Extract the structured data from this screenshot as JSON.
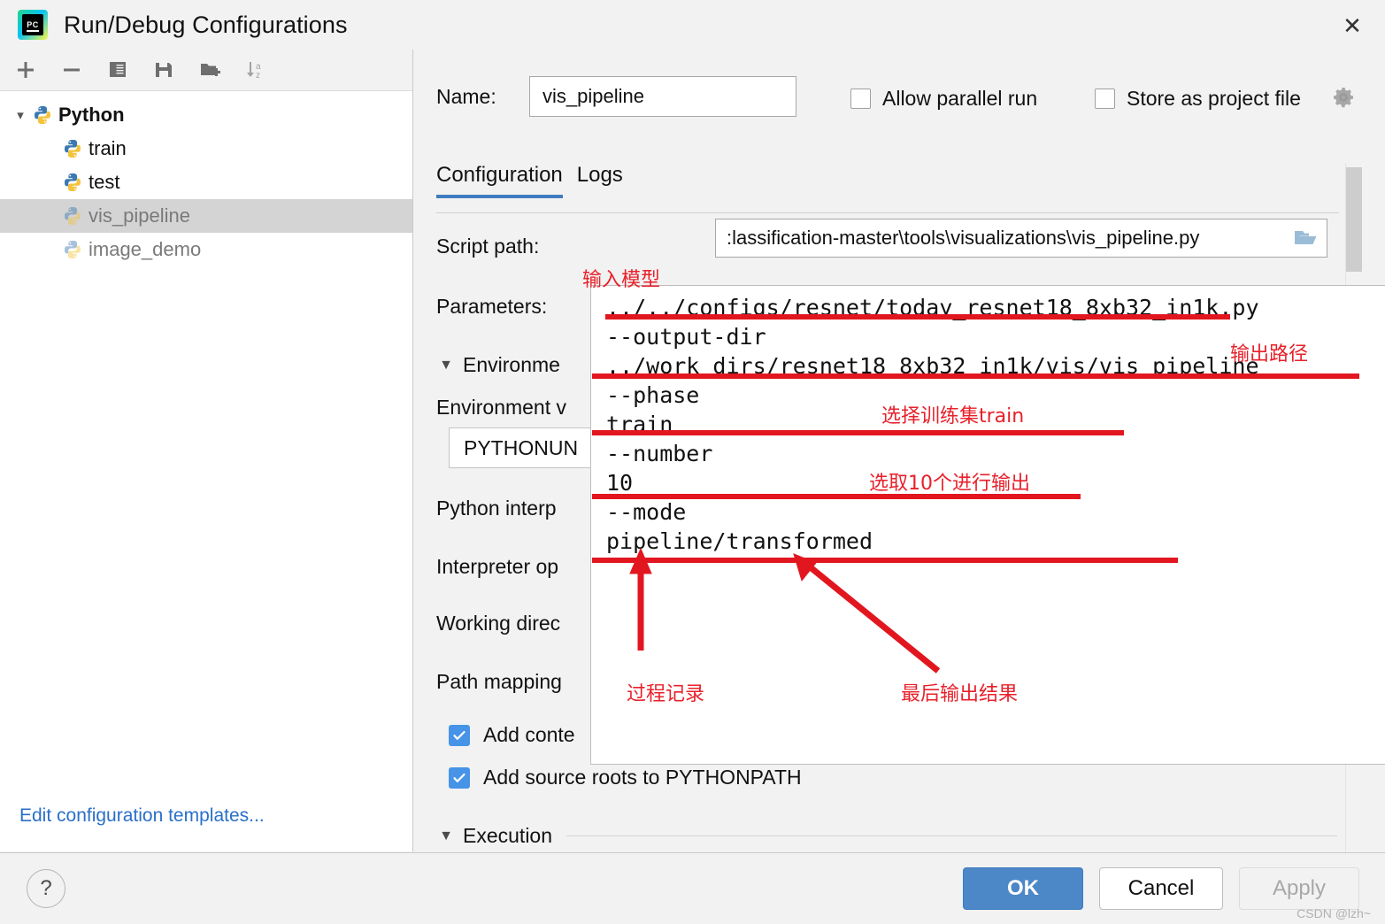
{
  "window": {
    "title": "Run/Debug Configurations",
    "logo_text": "PC",
    "close_icon": "close-icon"
  },
  "toolbar": {
    "items": [
      {
        "name": "add-configuration",
        "icon": "plus-icon"
      },
      {
        "name": "remove-configuration",
        "icon": "minus-icon"
      },
      {
        "name": "copy-configuration",
        "icon": "copy-icon"
      },
      {
        "name": "save-configuration",
        "icon": "save-icon"
      },
      {
        "name": "new-folder",
        "icon": "folder-add-icon"
      },
      {
        "name": "sort-alphabetically",
        "icon": "sort-az-icon"
      }
    ]
  },
  "sidebar": {
    "group": {
      "label": "Python",
      "icon": "python-icon"
    },
    "items": [
      {
        "label": "train",
        "icon": "python-icon",
        "selected": false,
        "dim": false
      },
      {
        "label": "test",
        "icon": "python-icon",
        "selected": false,
        "dim": false
      },
      {
        "label": "vis_pipeline",
        "icon": "python-icon",
        "selected": true,
        "dim": true
      },
      {
        "label": "image_demo",
        "icon": "python-icon",
        "selected": false,
        "dim": true
      }
    ],
    "edit_templates": "Edit configuration templates..."
  },
  "header": {
    "name_label": "Name:",
    "name_value": "vis_pipeline",
    "allow_parallel_run": "Allow parallel run",
    "store_as_project_file": "Store as project file",
    "gear_icon": "gear-icon"
  },
  "tabs": [
    {
      "label": "Configuration",
      "active": true
    },
    {
      "label": "Logs",
      "active": false
    }
  ],
  "form": {
    "script_path_label": "Script path:",
    "script_path_value": ":lassification-master\\tools\\visualizations\\vis_pipeline.py",
    "script_path_caret": "chevron-down-icon",
    "browse_icon": "folder-open-icon",
    "parameters_label": "Parameters:",
    "environment_section": "Environme",
    "environment_vars_label": "Environment v",
    "environment_vars_value": "PYTHONUN",
    "python_interpreter_label": "Python interp",
    "interpreter_options_label": "Interpreter op",
    "working_directory_label": "Working direc",
    "path_mappings_label": "Path mapping",
    "add_content_roots": "Add conte",
    "add_source_roots": "Add source roots to PYTHONPATH",
    "execution_section": "Execution"
  },
  "parameters_popup": {
    "lines": [
      "../../configs/resnet/today_resnet18_8xb32_in1k.py",
      "--output-dir",
      "../work_dirs/resnet18_8xb32_in1k/vis/vis_pipeline",
      "--phase",
      "train",
      "--number",
      "10",
      "--mode",
      "pipeline/transformed"
    ]
  },
  "annotations": {
    "color": "#e2161f",
    "items": [
      {
        "text": "输入模型",
        "name": "annotation-input-model"
      },
      {
        "text": "输出路径",
        "name": "annotation-output-path"
      },
      {
        "text": "选择训练集train",
        "name": "annotation-select-train"
      },
      {
        "text": "选取10个进行输出",
        "name": "annotation-select-10"
      },
      {
        "text": "过程记录",
        "name": "annotation-process-record"
      },
      {
        "text": "最后输出结果",
        "name": "annotation-final-output"
      }
    ]
  },
  "footer": {
    "help": "?",
    "ok": "OK",
    "cancel": "Cancel",
    "apply": "Apply",
    "watermark": "CSDN @lzh~"
  }
}
